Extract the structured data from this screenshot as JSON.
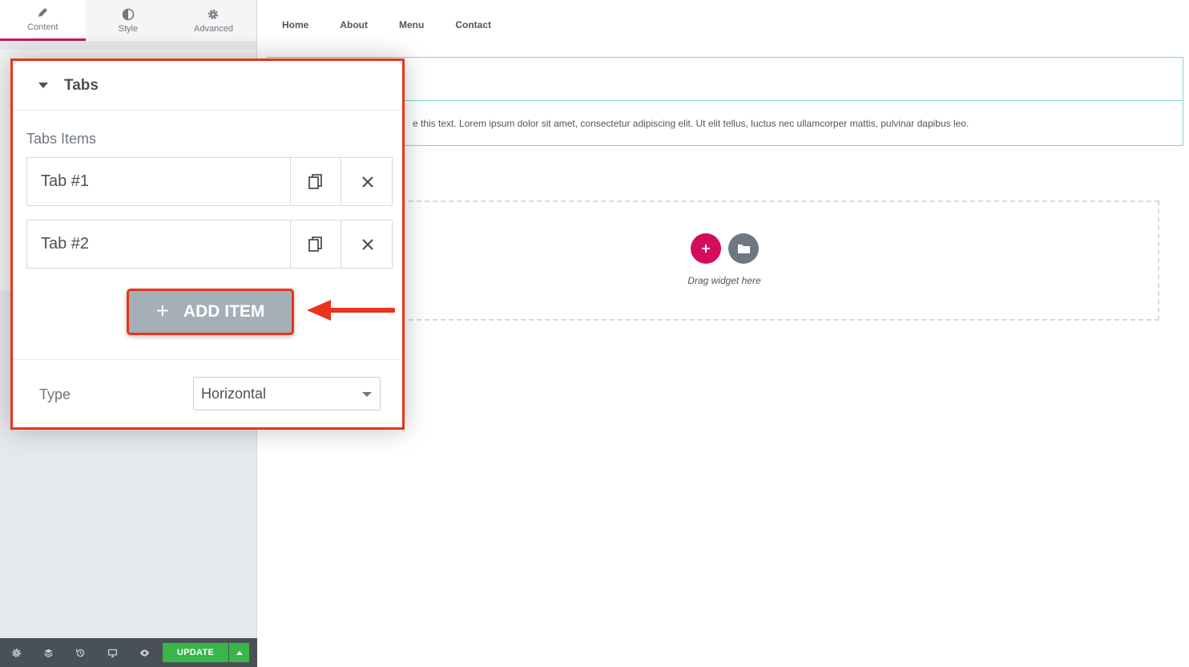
{
  "sidebar": {
    "tabs": [
      {
        "label": "Content",
        "icon": "pencil-icon",
        "active": true
      },
      {
        "label": "Style",
        "icon": "half-circle-icon",
        "active": false
      },
      {
        "label": "Advanced",
        "icon": "gear-icon",
        "active": false
      }
    ],
    "accent_color": "#c2185b"
  },
  "panel": {
    "title": "Tabs",
    "items_label": "Tabs Items",
    "items": [
      {
        "title": "Tab #1"
      },
      {
        "title": "Tab #2"
      }
    ],
    "add_item_label": "ADD ITEM",
    "type_label": "Type",
    "type_value": "Horizontal",
    "highlight_color": "#e8341c"
  },
  "preview": {
    "nav": [
      "Home",
      "About",
      "Menu",
      "Contact"
    ],
    "tab_content_text": "e this text. Lorem ipsum dolor sit amet, consectetur adipiscing elit. Ut elit tellus, luctus nec ullamcorper mattis, pulvinar dapibus leo.",
    "drop_text": "Drag widget here"
  },
  "bottom_bar": {
    "icons": [
      "settings-icon",
      "layers-icon",
      "history-icon",
      "responsive-icon",
      "preview-eye-icon"
    ],
    "update_label": "UPDATE",
    "update_color": "#39b54a"
  }
}
